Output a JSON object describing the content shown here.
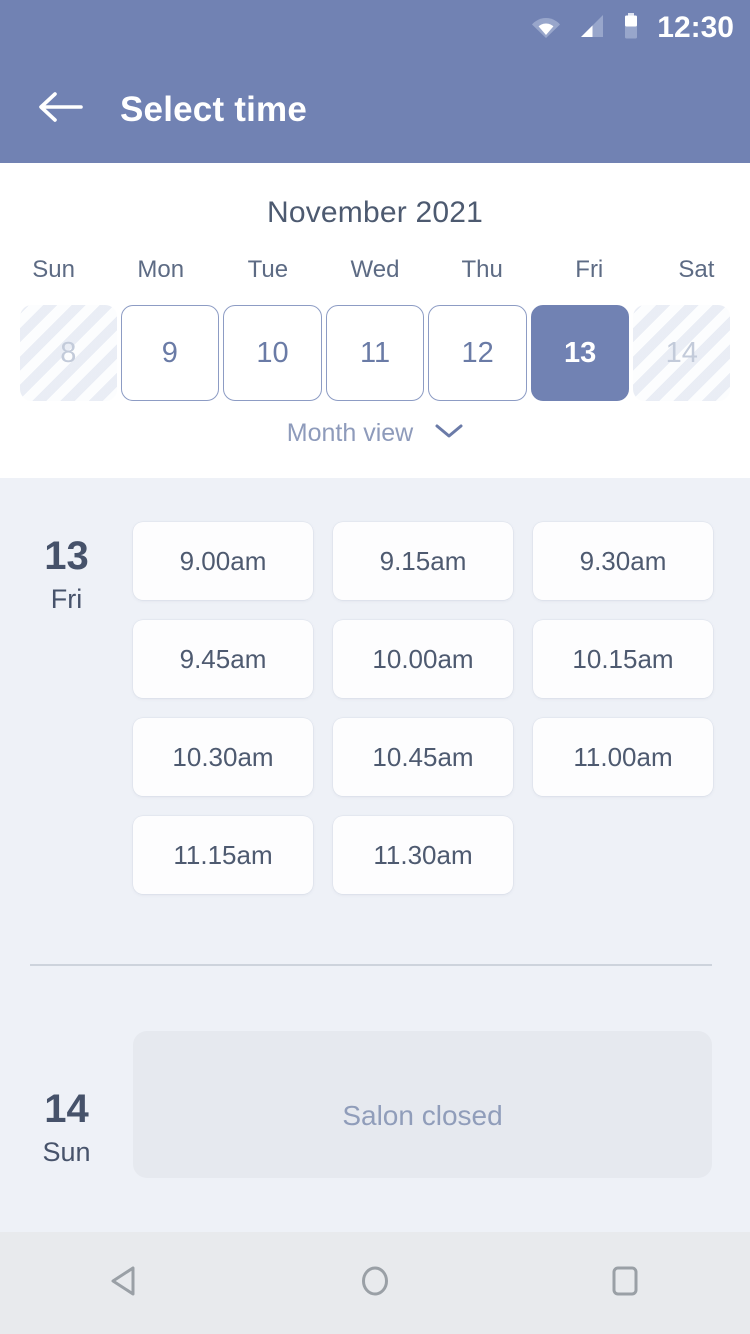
{
  "status_bar": {
    "time": "12:30",
    "icons": [
      "wifi-icon",
      "cellular-signal-icon",
      "battery-icon"
    ]
  },
  "app_bar": {
    "back_icon": "arrow-left-icon",
    "title": "Select time"
  },
  "calendar": {
    "month_label": "November 2021",
    "day_of_week_headers": [
      "Sun",
      "Mon",
      "Tue",
      "Wed",
      "Thu",
      "Fri",
      "Sat"
    ],
    "days": [
      {
        "number": "8",
        "state": "disabled"
      },
      {
        "number": "9",
        "state": "enabled"
      },
      {
        "number": "10",
        "state": "enabled"
      },
      {
        "number": "11",
        "state": "enabled"
      },
      {
        "number": "12",
        "state": "enabled"
      },
      {
        "number": "13",
        "state": "selected"
      },
      {
        "number": "14",
        "state": "disabled"
      }
    ],
    "view_toggle": {
      "label": "Month view",
      "chevron_icon": "chevron-down-icon"
    }
  },
  "schedule": {
    "days": [
      {
        "date_number": "13",
        "day_of_week": "Fri",
        "slots": [
          "9.00am",
          "9.15am",
          "9.30am",
          "9.45am",
          "10.00am",
          "10.15am",
          "10.30am",
          "10.45am",
          "11.00am",
          "11.15am",
          "11.30am"
        ]
      },
      {
        "date_number": "14",
        "day_of_week": "Sun",
        "closed_message": "Salon closed"
      }
    ]
  },
  "nav_bar": {
    "back_icon": "android-back-triangle-icon",
    "home_icon": "android-home-circle-icon",
    "recents_icon": "android-recents-square-icon"
  },
  "colors": {
    "header": "#7182b3",
    "accent": "#7182b3",
    "body_bg": "#eef1f7",
    "slot_bg": "#fdfdfe",
    "closed_bg": "#e6e9ef",
    "text_dark": "#46526a",
    "text_muted": "#8e9bbb",
    "nav_bg": "#e8eaed"
  }
}
